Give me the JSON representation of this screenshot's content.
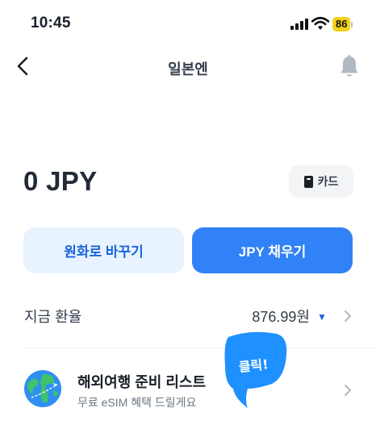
{
  "status_bar": {
    "time": "10:45",
    "battery_level": "86",
    "icons": [
      "signal-icon",
      "wifi-icon",
      "battery-icon"
    ]
  },
  "nav": {
    "title": "일본엔",
    "icons": [
      "back-icon",
      "bell-icon"
    ]
  },
  "balance": {
    "amount": "0 JPY",
    "card_button_label": "카드",
    "card_icon": "card-icon"
  },
  "actions": {
    "exchange_label": "원화로 바꾸기",
    "fill_label": "JPY 채우기"
  },
  "rate": {
    "label": "지금 환율",
    "value": "876.99원",
    "trend_icon": "▼",
    "trend_color": "#1b64da"
  },
  "promo": {
    "title": "해외여행 준비 리스트",
    "subtitle": "무료 eSIM 혜택 드릴게요",
    "icon": "globe-icon"
  },
  "callout": {
    "text": "클릭!",
    "color": "#1e90ff"
  },
  "colors": {
    "primary": "#3182f6",
    "primary_light": "#e8f3ff",
    "primary_text": "#1b64da",
    "battery": "#f2d21b"
  }
}
